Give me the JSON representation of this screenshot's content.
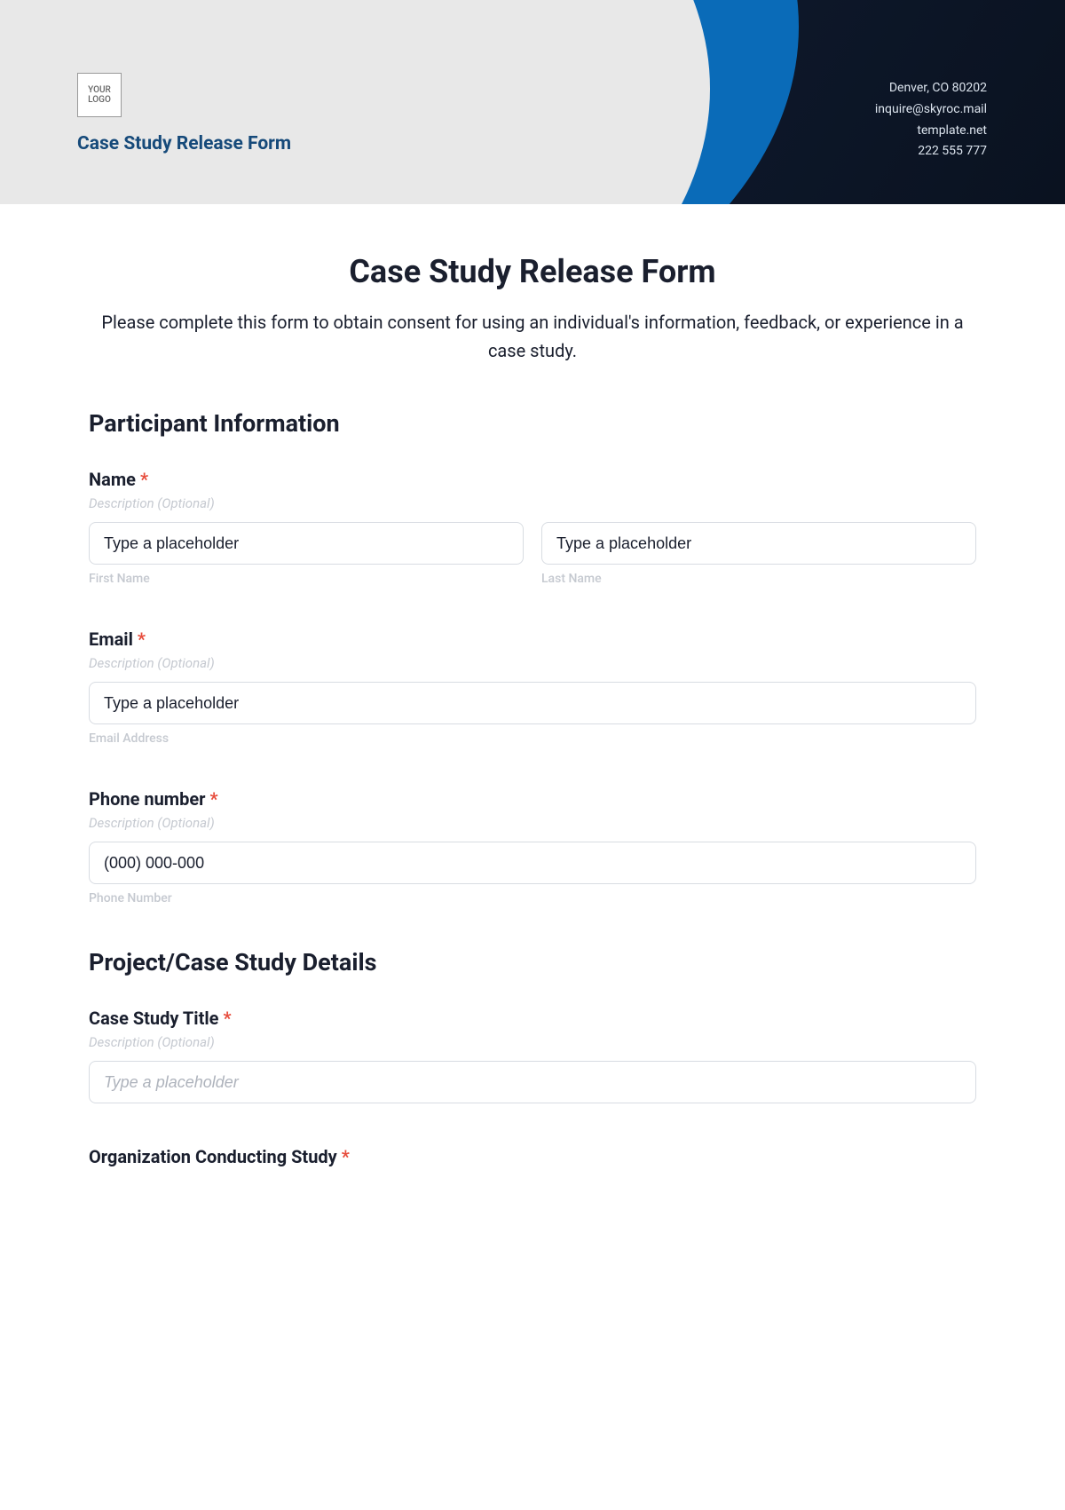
{
  "header": {
    "logo_text": "YOUR LOGO",
    "title": "Case Study Release Form",
    "contact": {
      "address": "Denver, CO 80202",
      "email": "inquire@skyroc.mail",
      "site": "template.net",
      "phone": "222 555 777"
    }
  },
  "form": {
    "title": "Case Study Release Form",
    "subtitle": "Please complete this form to obtain consent for using an individual's information, feedback, or experience in a case study.",
    "required_mark": "*",
    "desc_placeholder": "Description (Optional)",
    "section1": {
      "title": "Participant Information",
      "name": {
        "label": "Name",
        "first_placeholder": "Type a placeholder",
        "first_sub": "First Name",
        "last_placeholder": "Type a placeholder",
        "last_sub": "Last Name"
      },
      "email": {
        "label": "Email",
        "placeholder": "Type a placeholder",
        "sub": "Email Address"
      },
      "phone": {
        "label": "Phone number",
        "placeholder": "(000) 000-000",
        "sub": "Phone Number"
      }
    },
    "section2": {
      "title": "Project/Case Study Details",
      "cstitle": {
        "label": "Case Study Title",
        "placeholder": "Type a placeholder"
      },
      "org": {
        "label": "Organization Conducting Study"
      }
    }
  }
}
